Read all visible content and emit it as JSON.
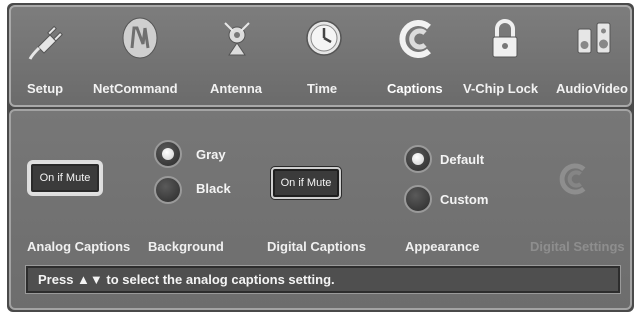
{
  "nav": {
    "tabs": [
      {
        "label": "Setup",
        "icon": "plug-icon"
      },
      {
        "label": "NetCommand",
        "icon": "netcommand-logo-icon"
      },
      {
        "label": "Antenna",
        "icon": "antenna-icon"
      },
      {
        "label": "Time",
        "icon": "clock-icon"
      },
      {
        "label": "Captions",
        "icon": "captions-icon",
        "active": true
      },
      {
        "label": "V-Chip Lock",
        "icon": "padlock-icon"
      },
      {
        "label": "AudioVideo",
        "icon": "speakers-icon"
      }
    ]
  },
  "analog_captions": {
    "button_label": "On if Mute",
    "label": "Analog Captions"
  },
  "background": {
    "label": "Background",
    "options": [
      {
        "label": "Gray",
        "selected": true
      },
      {
        "label": "Black",
        "selected": false
      }
    ]
  },
  "digital_captions": {
    "button_label": "On if Mute",
    "label": "Digital Captions"
  },
  "appearance": {
    "label": "Appearance",
    "options": [
      {
        "label": "Default",
        "selected": true
      },
      {
        "label": "Custom",
        "selected": false
      }
    ]
  },
  "digital_settings": {
    "label": "Digital Settings",
    "icon": "captions-icon",
    "disabled": true
  },
  "status": {
    "text": "Press ▲▼ to select the analog captions setting."
  },
  "colors": {
    "panel": "#777777",
    "frame": "#4a4a4a",
    "text": "#f4f4f4",
    "disabled": "#8e8e8e"
  }
}
